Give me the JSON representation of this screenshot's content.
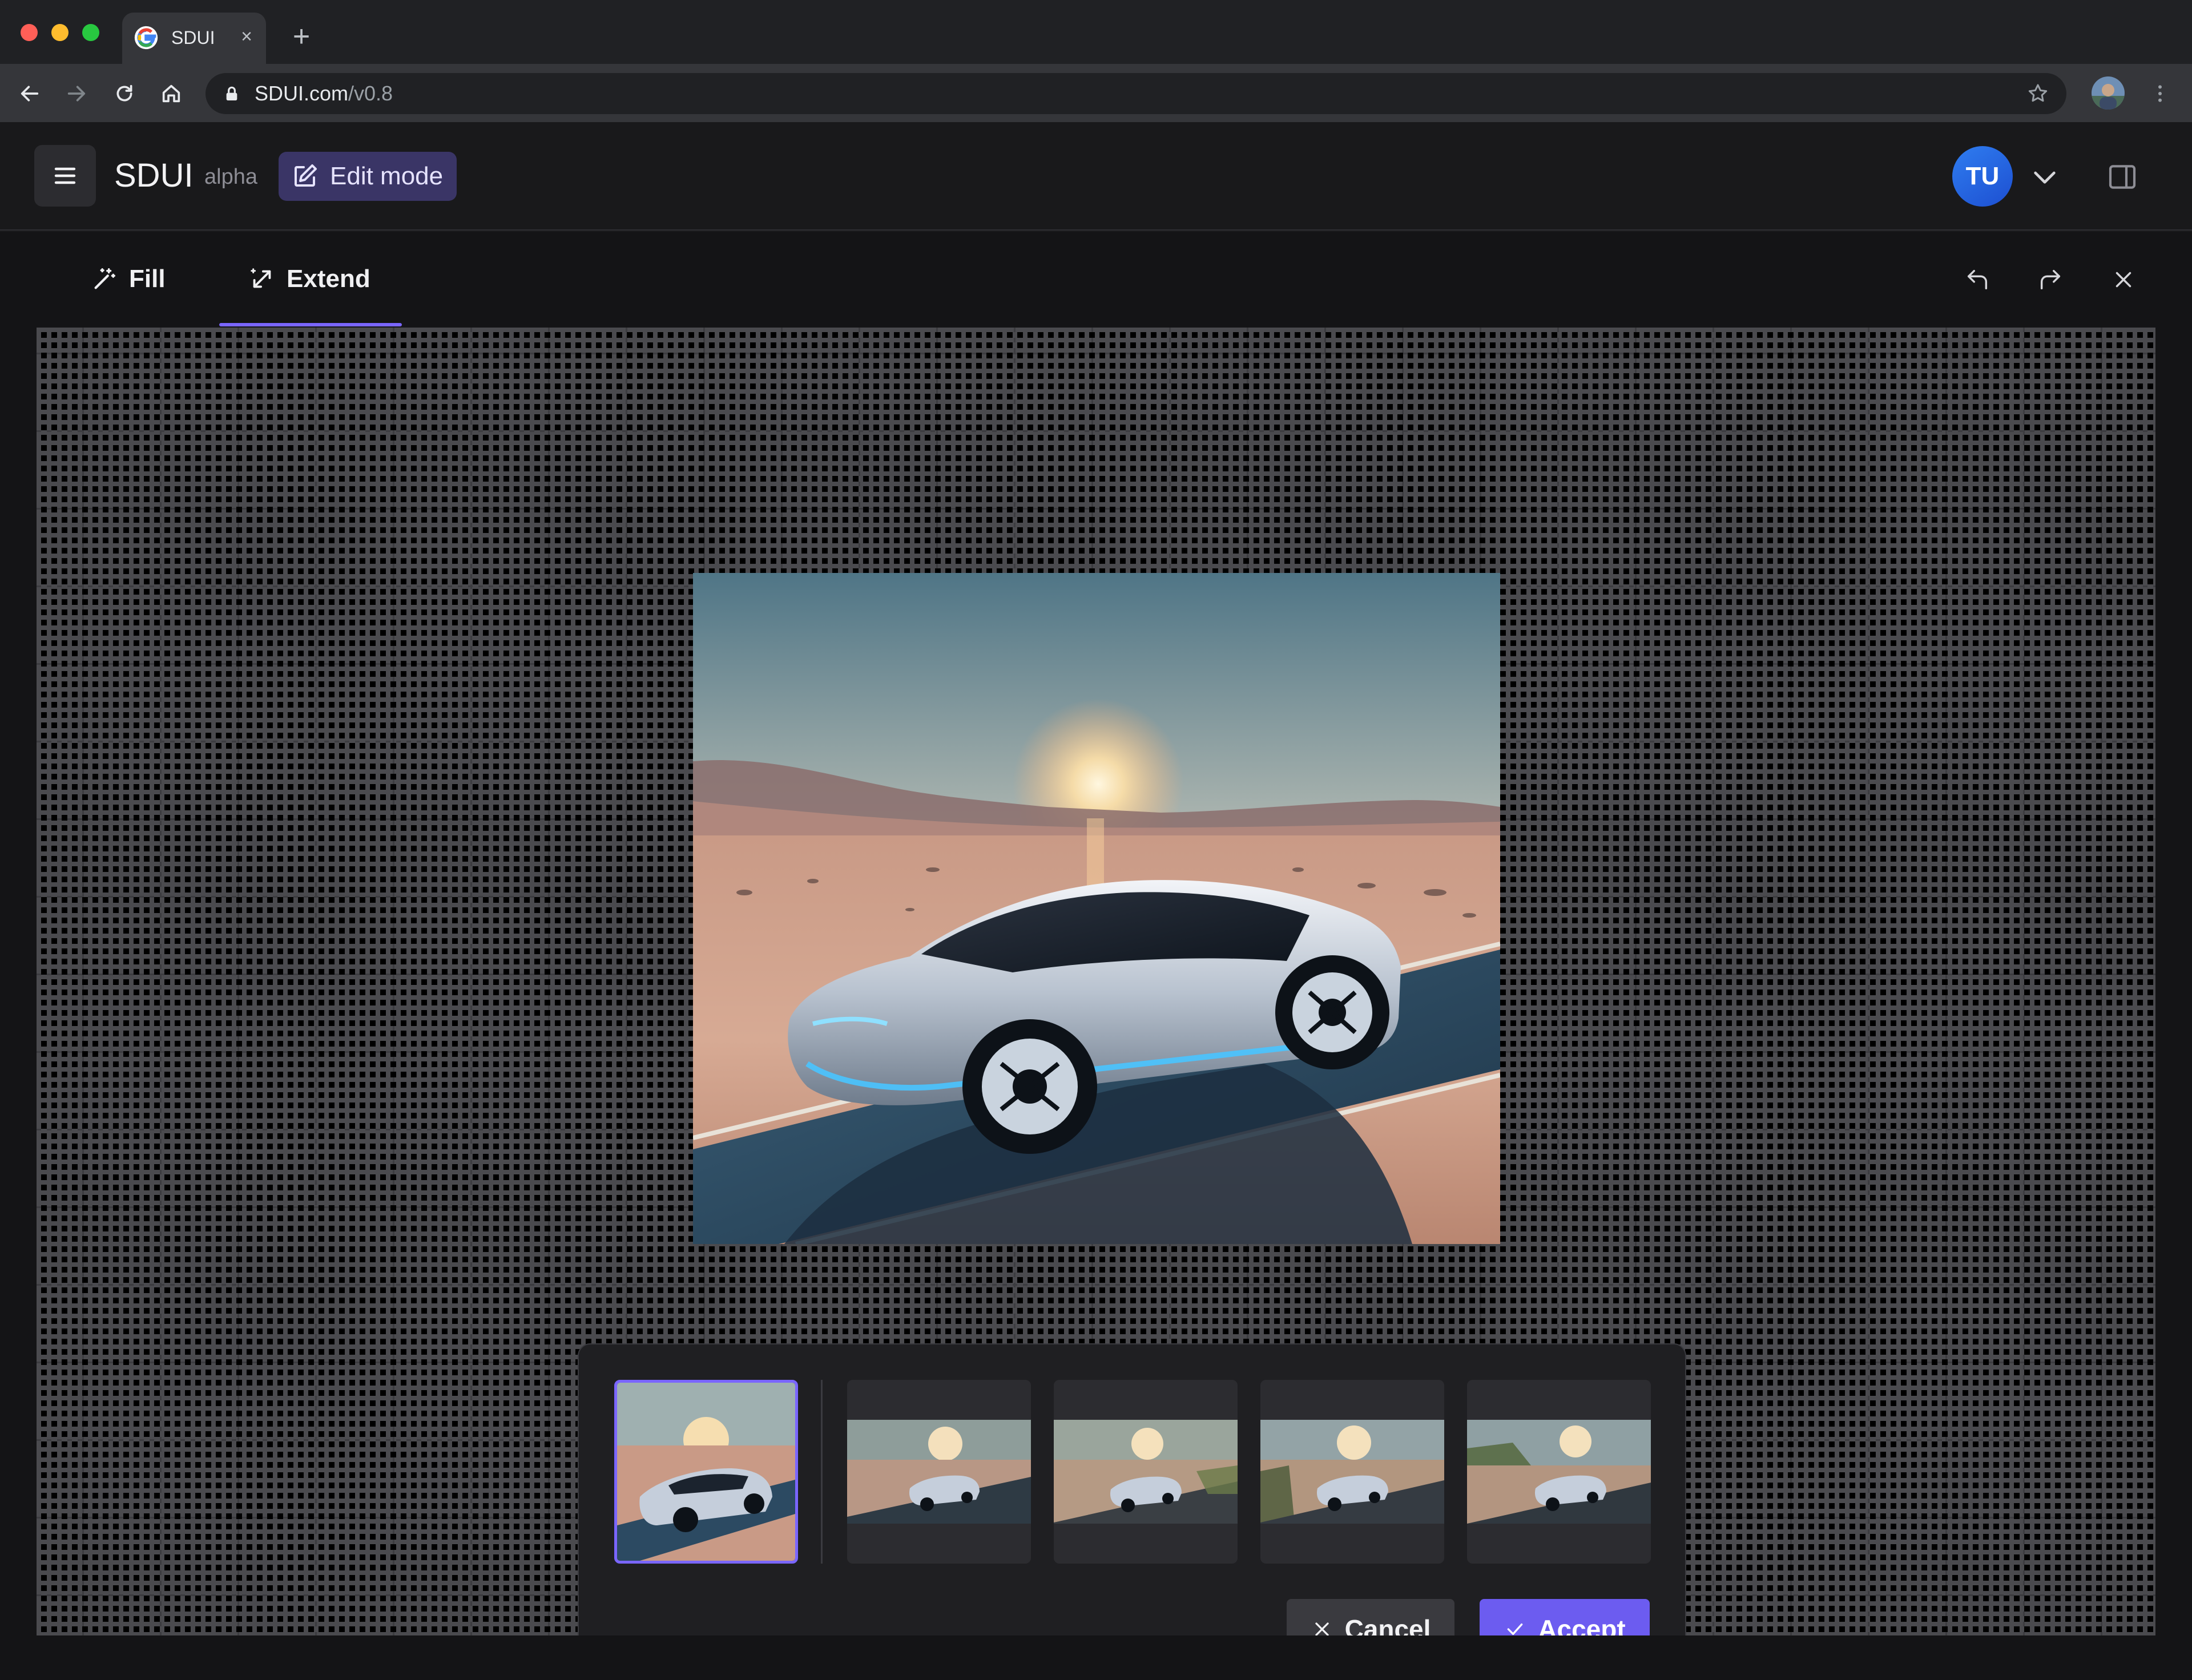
{
  "browser": {
    "tab_title": "SDUI",
    "tab_close": "×",
    "new_tab": "+",
    "url_host": "SDUI.com",
    "url_path": "/v0.8"
  },
  "header": {
    "title": "SDUI",
    "badge": "alpha",
    "edit_mode_label": "Edit mode",
    "user_initials": "TU"
  },
  "editor": {
    "tabs": [
      {
        "label": "Fill",
        "icon": "magic-wand-icon"
      },
      {
        "label": "Extend",
        "icon": "expand-arrows-icon",
        "active": true
      }
    ],
    "history": [
      "undo-icon",
      "redo-icon",
      "close-icon"
    ]
  },
  "variations": {
    "selected_index": 0,
    "count": 5,
    "cancel_label": "Cancel",
    "accept_label": "Accept"
  },
  "colors": {
    "accent": "#6c5cf0",
    "accent_outline": "#7a66ff",
    "edit_pill_bg": "#3a3566",
    "avatar_blue": "#2f7df0"
  }
}
